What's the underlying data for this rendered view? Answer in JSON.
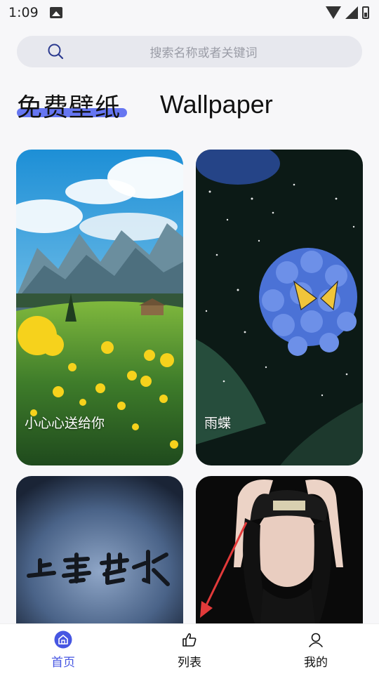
{
  "status_bar": {
    "time": "1:09"
  },
  "search": {
    "placeholder": "搜索名称或者关键词"
  },
  "title": {
    "chinese": "免费壁纸",
    "english": "Wallpaper"
  },
  "wallpapers": [
    {
      "caption": "小心心送给你",
      "image": "mountain meadow with yellow flowers"
    },
    {
      "caption": "雨蝶",
      "image": "blue hydrangea with butterfly"
    },
    {
      "caption": "",
      "image": "calligraphy 上善若水 on dark blue"
    },
    {
      "caption": "",
      "image": "person in black cap with red arrow"
    }
  ],
  "tabs": [
    {
      "label": "首页",
      "icon": "home-icon",
      "active": true
    },
    {
      "label": "列表",
      "icon": "thumbs-up-icon",
      "active": false
    },
    {
      "label": "我的",
      "icon": "user-icon",
      "active": false
    }
  ],
  "colors": {
    "accent": "#4656e2",
    "underline": "#5e6ff0",
    "search_bg": "#e7e8ee"
  }
}
